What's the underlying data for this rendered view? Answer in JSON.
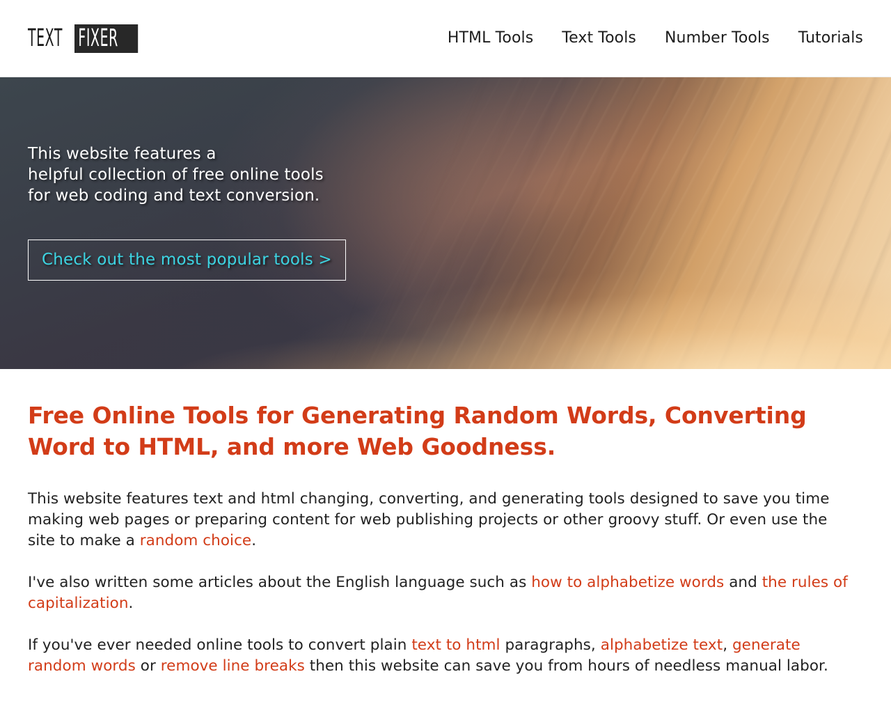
{
  "header": {
    "logo": {
      "part1": "TEXT",
      "part2": "FIXER"
    },
    "nav": [
      {
        "label": "HTML Tools"
      },
      {
        "label": "Text Tools"
      },
      {
        "label": "Number Tools"
      },
      {
        "label": "Tutorials"
      }
    ]
  },
  "hero": {
    "tagline": "This website features a\nhelpful collection of free online tools\nfor web coding and text conversion.",
    "cta_label": "Check out the most popular tools >",
    "cta_text_color": "#3dd4e2",
    "background_description": "sunset sky photo with orange cloud streaks over dark slate"
  },
  "main": {
    "title": "Free Online Tools for Generating Random Words, Converting Word to HTML, and more Web Goodness.",
    "accent_color": "#d23c18",
    "paragraphs": [
      {
        "parts": [
          {
            "type": "text",
            "value": "This website features text and html changing, converting, and generating tools designed to save you time making web pages or preparing content for web publishing projects or other groovy stuff. Or even use the site to make a "
          },
          {
            "type": "link",
            "value": "random choice"
          },
          {
            "type": "text",
            "value": "."
          }
        ]
      },
      {
        "parts": [
          {
            "type": "text",
            "value": "I've also written some articles about the English language such as "
          },
          {
            "type": "link",
            "value": "how to alphabetize words"
          },
          {
            "type": "text",
            "value": " and "
          },
          {
            "type": "link",
            "value": "the rules of capitalization"
          },
          {
            "type": "text",
            "value": "."
          }
        ]
      },
      {
        "parts": [
          {
            "type": "text",
            "value": "If you've ever needed online tools to convert plain "
          },
          {
            "type": "link",
            "value": "text to html"
          },
          {
            "type": "text",
            "value": " paragraphs, "
          },
          {
            "type": "link",
            "value": "alphabetize text"
          },
          {
            "type": "text",
            "value": ", "
          },
          {
            "type": "link",
            "value": "generate random words"
          },
          {
            "type": "text",
            "value": " or "
          },
          {
            "type": "link",
            "value": "remove line breaks"
          },
          {
            "type": "text",
            "value": " then this website can save you from hours of needless manual labor."
          }
        ]
      }
    ]
  }
}
